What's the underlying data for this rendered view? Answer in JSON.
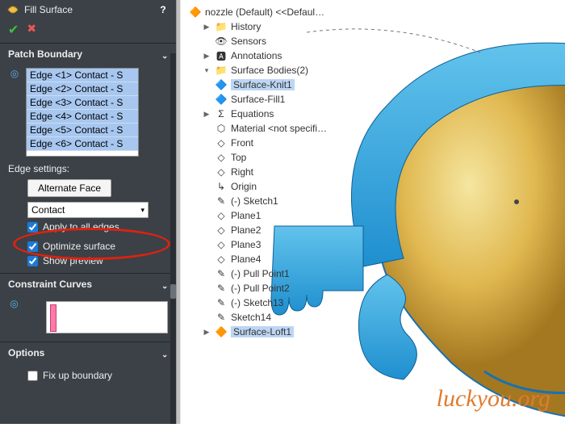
{
  "panel": {
    "title": "Fill Surface",
    "help_icon": "?",
    "ok_icon": "✔",
    "cancel_icon": "✖"
  },
  "boundary": {
    "heading": "Patch Boundary",
    "edges": [
      "Edge <1> Contact - S",
      "Edge <2> Contact - S",
      "Edge <3> Contact - S",
      "Edge <4> Contact - S",
      "Edge <5> Contact - S",
      "Edge <6> Contact - S"
    ],
    "edge_settings_label": "Edge settings:",
    "alternate_face_btn": "Alternate Face",
    "contact_dropdown": "Contact",
    "chk_apply_all": "Apply to all edges",
    "chk_optimize": "Optimize surface",
    "chk_preview": "Show preview"
  },
  "constraint": {
    "heading": "Constraint Curves"
  },
  "options": {
    "heading": "Options",
    "chk_fixup": "Fix up boundary"
  },
  "tree": {
    "root": "nozzle (Default) <<Defaul…",
    "history": "History",
    "sensors": "Sensors",
    "annotations": "Annotations",
    "surface_bodies": "Surface Bodies(2)",
    "surface_knit": "Surface-Knit1",
    "surface_fill": "Surface-Fill1",
    "equations": "Equations",
    "material": "Material <not specifi…",
    "front": "Front",
    "top": "Top",
    "right": "Right",
    "origin": "Origin",
    "sketch1": "(-) Sketch1",
    "plane1": "Plane1",
    "plane2": "Plane2",
    "plane3": "Plane3",
    "plane4": "Plane4",
    "pull1": "(-) Pull Point1",
    "pull2": "(-) Pull Point2",
    "sketch13": "(-) Sketch13",
    "sketch14": "Sketch14",
    "loft": "Surface-Loft1"
  },
  "watermark": "luckyou.org"
}
